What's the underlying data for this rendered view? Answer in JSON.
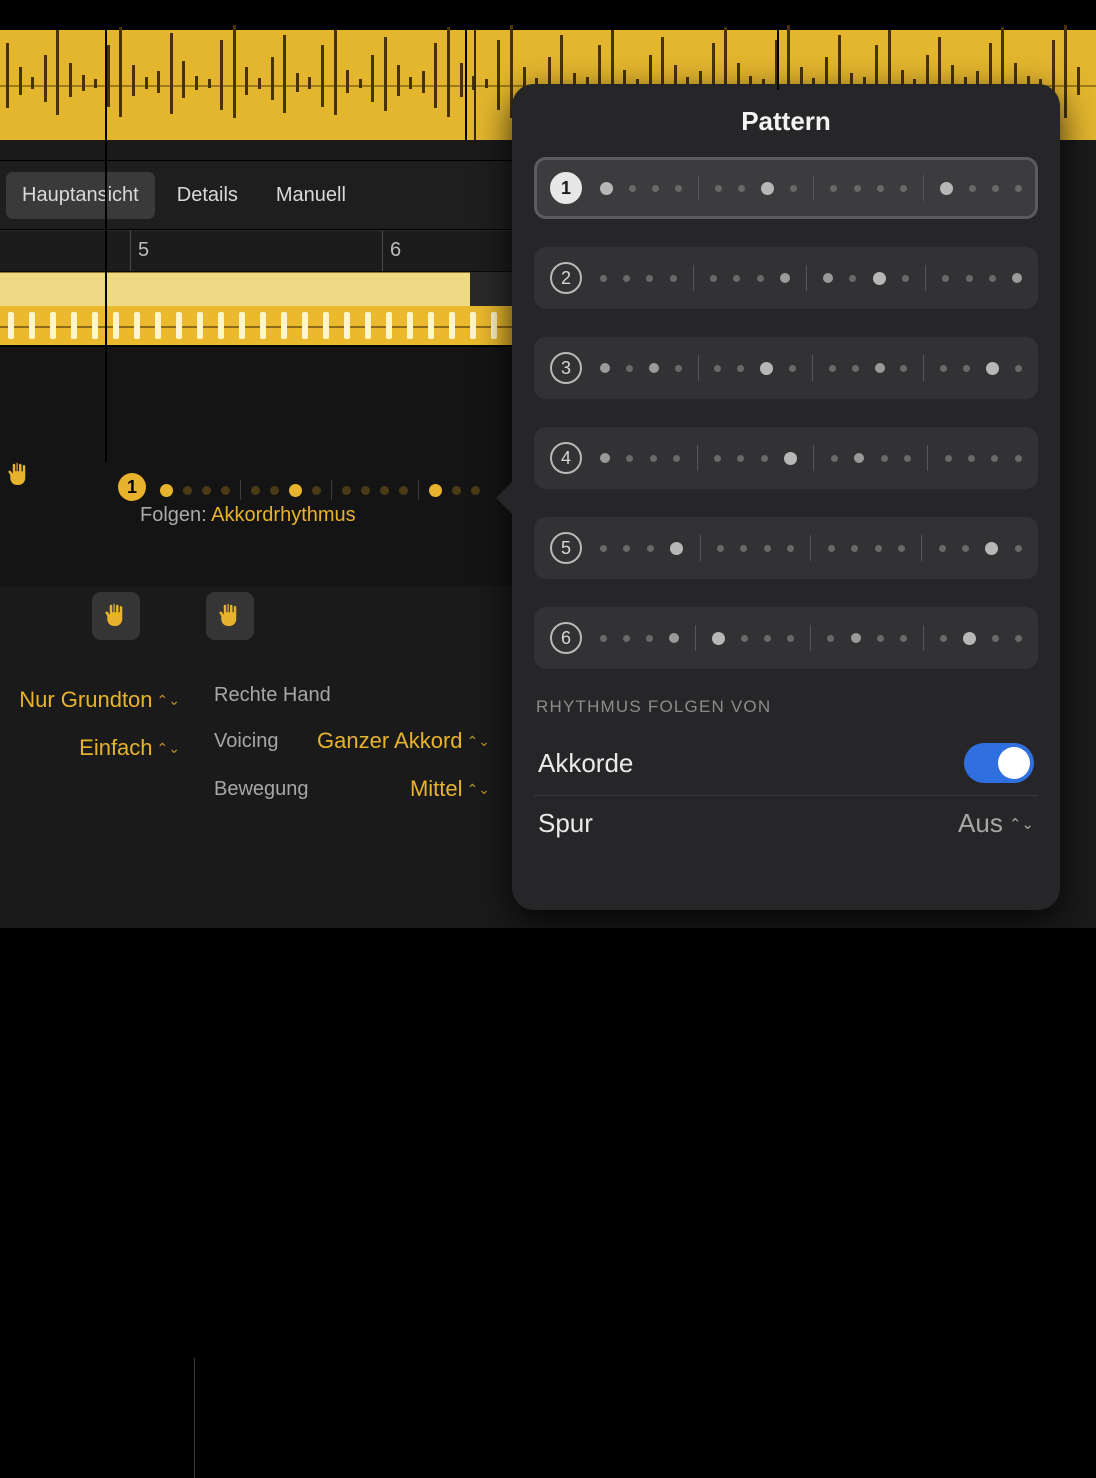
{
  "tabs": {
    "main": "Hauptansicht",
    "details": "Details",
    "manual": "Manuell"
  },
  "ruler": {
    "m5": "5",
    "m6": "6"
  },
  "editor": {
    "badge": "1",
    "follow_label": "Folgen: ",
    "follow_value": "Akkordrhythmus"
  },
  "left_params": {
    "root": "Nur Grundton",
    "simple": "Einfach"
  },
  "right_params": {
    "heading": "Rechte Hand",
    "voicing_label": "Voicing",
    "voicing_value": "Ganzer Akkord",
    "motion_label": "Bewegung",
    "motion_value": "Mittel"
  },
  "popover": {
    "title": "Pattern",
    "patterns": [
      "1",
      "2",
      "3",
      "4",
      "5",
      "6"
    ],
    "section": "RHYTHMUS FOLGEN VON",
    "akkorde": "Akkorde",
    "spur_label": "Spur",
    "spur_value": "Aus"
  }
}
